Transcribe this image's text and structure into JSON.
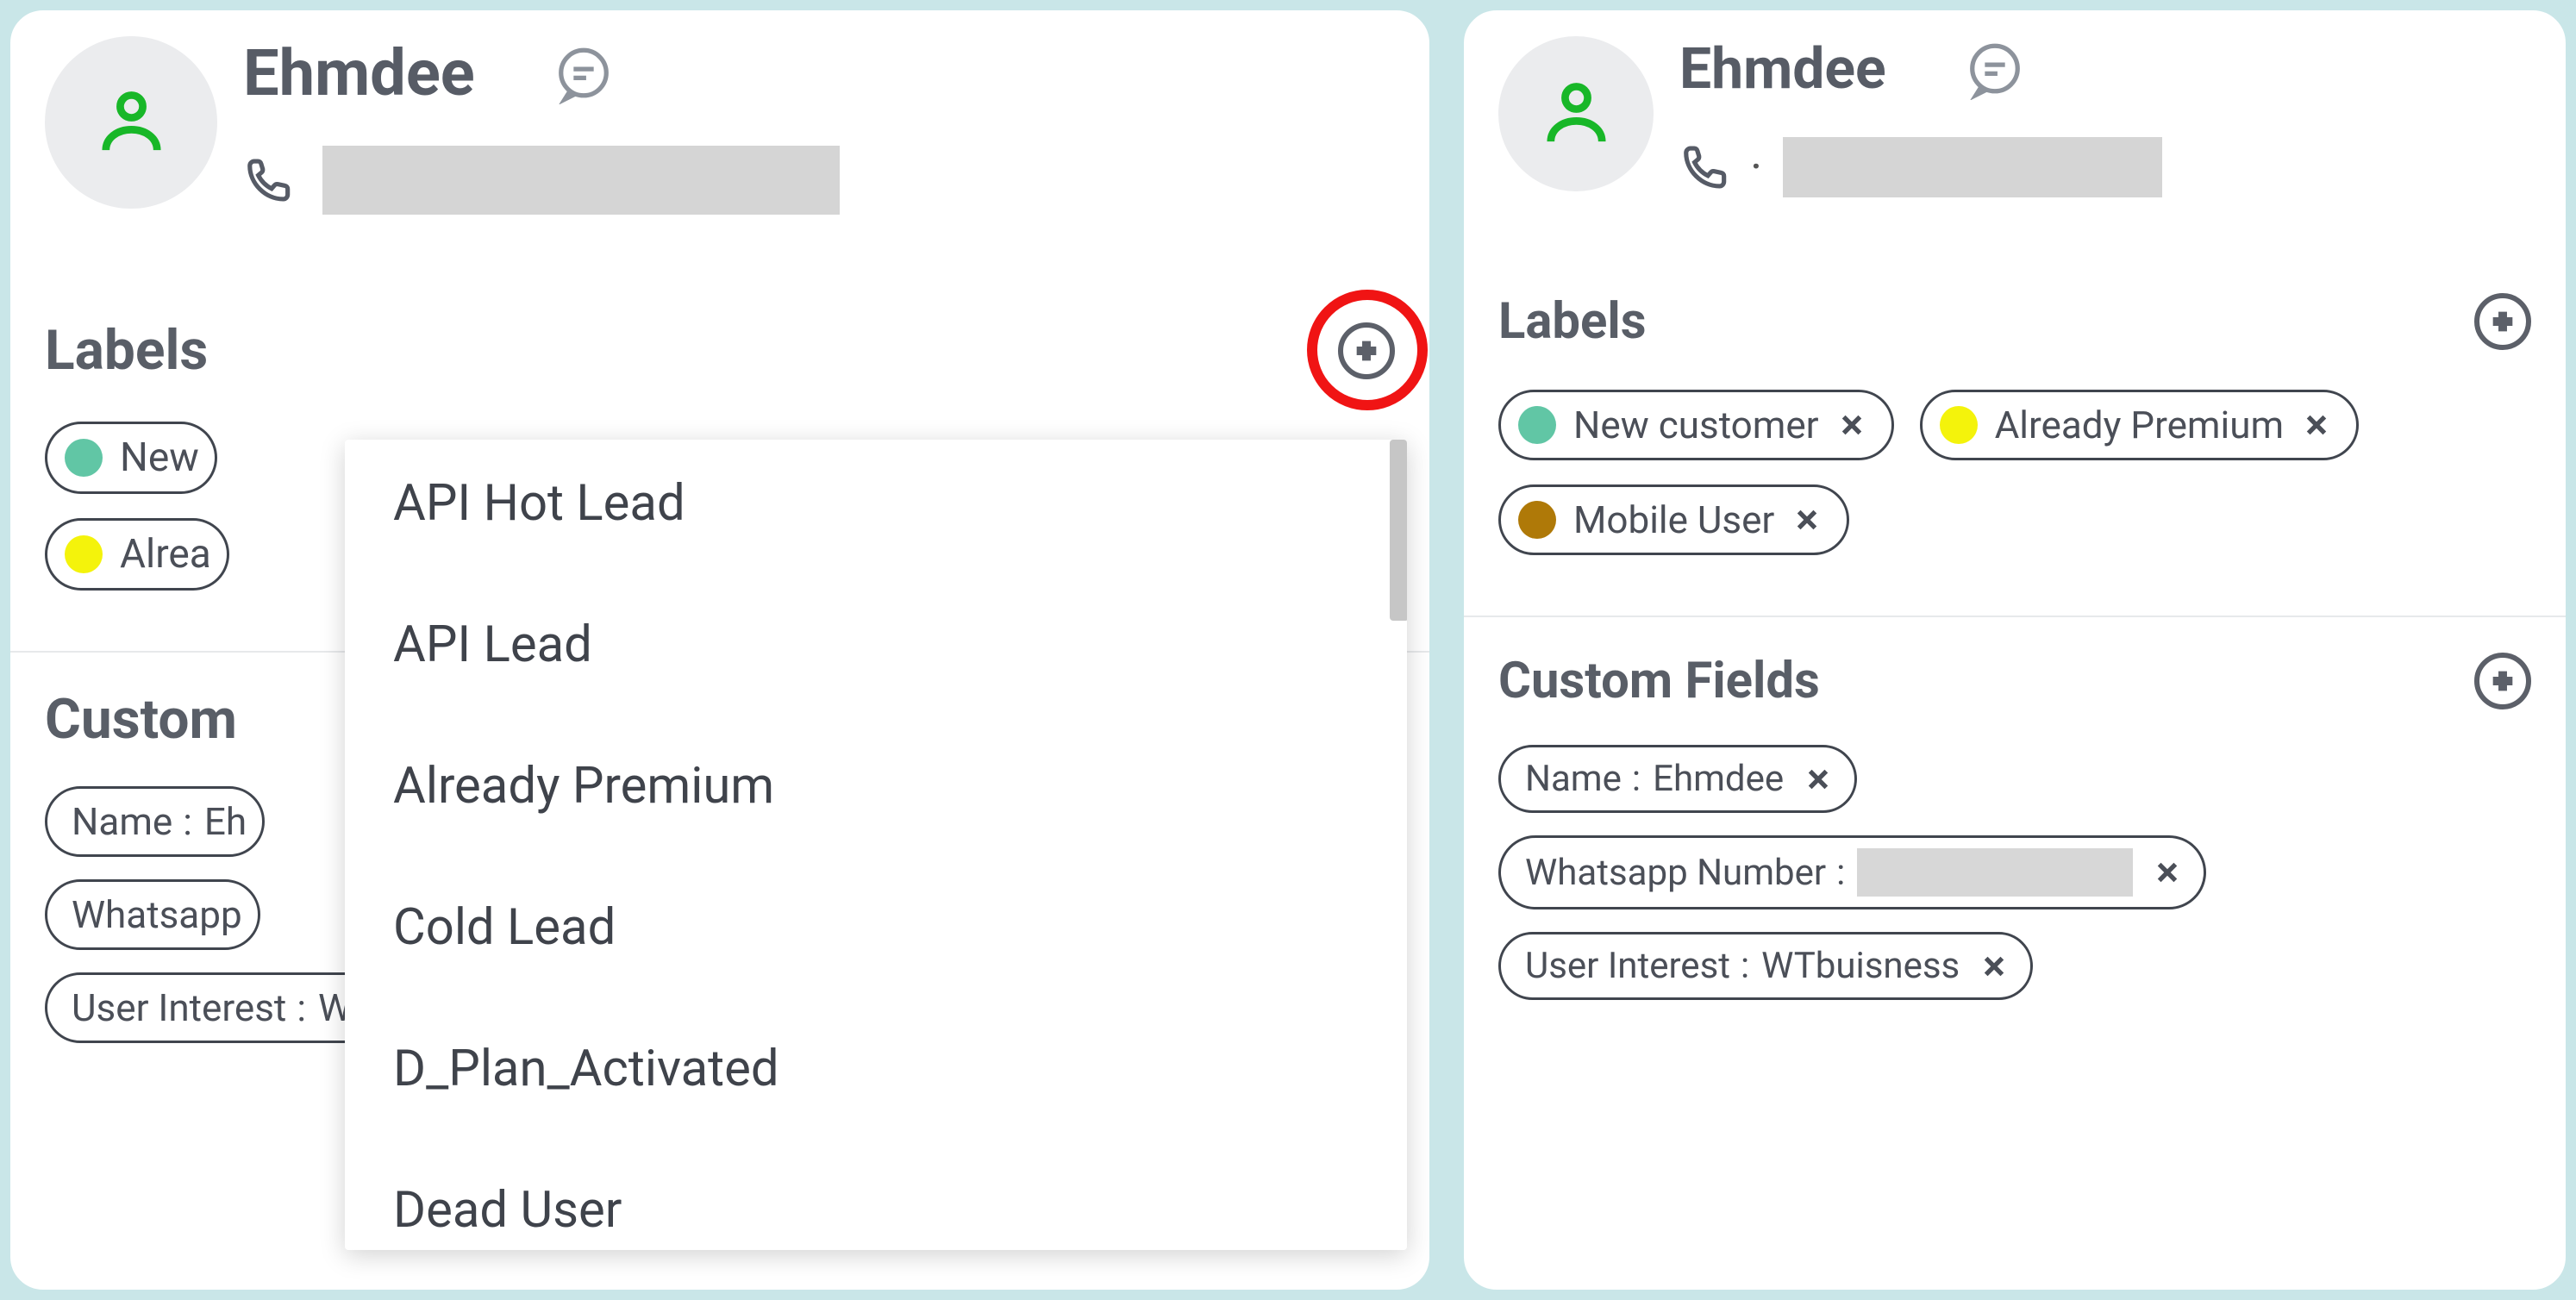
{
  "colors": {
    "teal": "#61c6a5",
    "yellow": "#f4f30b",
    "brown": "#af7908"
  },
  "left": {
    "contact_name": "Ehmdee",
    "labels_title": "Labels",
    "custom_fields_title": "Custom Fields",
    "labels": [
      {
        "text": "New",
        "color": "#61c6a5"
      },
      {
        "text": "Alrea",
        "color": "#f4f30b"
      }
    ],
    "dropdown": [
      "API Hot Lead",
      "API Lead",
      "Already Premium",
      "Cold Lead",
      "D_Plan_Activated",
      "Dead User"
    ],
    "custom_fields": [
      {
        "name": "Name",
        "value": "Eh",
        "redacted": false
      },
      {
        "name": "Whatsapp",
        "value": "",
        "redacted": false
      },
      {
        "name": "User Interest",
        "value": "WTbuisness",
        "redacted": false
      }
    ]
  },
  "right": {
    "contact_name": "Ehmdee",
    "labels_title": "Labels",
    "custom_fields_title": "Custom Fields",
    "labels": [
      {
        "text": "New customer",
        "color": "#61c6a5"
      },
      {
        "text": "Already Premium",
        "color": "#f4f30b"
      },
      {
        "text": "Mobile User",
        "color": "#af7908"
      }
    ],
    "custom_fields": [
      {
        "name": "Name",
        "value": "Ehmdee",
        "redacted": false
      },
      {
        "name": "Whatsapp Number",
        "value": "",
        "redacted": true
      },
      {
        "name": "User Interest",
        "value": "WTbuisness",
        "redacted": false
      }
    ]
  }
}
